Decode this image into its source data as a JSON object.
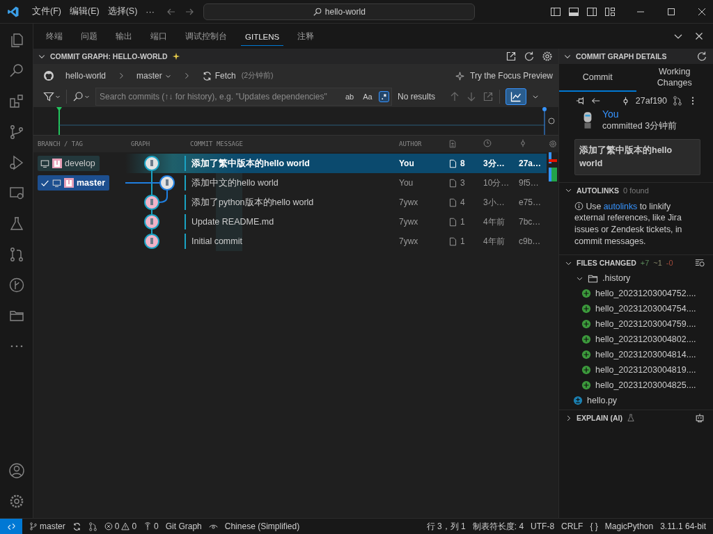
{
  "titlebar": {
    "menus": [
      "文件(F)",
      "编辑(E)",
      "选择(S)"
    ],
    "more": "···",
    "search_value": "hello-world"
  },
  "panel_tabs": [
    {
      "label": "终端",
      "selected": false
    },
    {
      "label": "问题",
      "selected": false
    },
    {
      "label": "输出",
      "selected": false
    },
    {
      "label": "端口",
      "selected": false
    },
    {
      "label": "调试控制台",
      "selected": false
    },
    {
      "label": "GITLENS",
      "selected": true
    },
    {
      "label": "注释",
      "selected": false
    }
  ],
  "graph": {
    "title": "COMMIT GRAPH: HELLO-WORLD",
    "repo": "hello-world",
    "branch": "master",
    "fetch": "Fetch",
    "fetch_time": "(2分钟前)",
    "focus": "Try the Focus Preview",
    "search_placeholder": "Search commits (↑↓ for history), e.g. \"Updates dependencies\"",
    "search_toggles": [
      {
        "label": "ab",
        "selected": false
      },
      {
        "label": "Aa",
        "selected": false
      },
      {
        "label": ".*",
        "selected": true
      }
    ],
    "no_results": "No results",
    "columns": [
      "BRANCH / TAG",
      "GRAPH",
      "COMMIT MESSAGE",
      "AUTHOR"
    ],
    "rows": [
      {
        "branch": {
          "name": "develop",
          "current": false
        },
        "kind": "main",
        "message": "添加了繁中版本的hello world",
        "author": "You",
        "files": "8",
        "time": "3分…",
        "sha": "27a…",
        "selected": true
      },
      {
        "branch": {
          "name": "master",
          "current": true
        },
        "kind": "side",
        "message": "添加中文的hello world",
        "author": "You",
        "files": "3",
        "time": "10分…",
        "sha": "9f5…",
        "selected": false
      },
      {
        "kind": "main",
        "message": "添加了python版本的hello world",
        "author": "7ywx",
        "files": "4",
        "time": "3小…",
        "sha": "e75…",
        "selected": false
      },
      {
        "kind": "main",
        "message": "Update README.md",
        "author": "7ywx",
        "files": "1",
        "time": "4年前",
        "sha": "7bc…",
        "selected": false
      },
      {
        "kind": "main",
        "message": "Initial commit",
        "author": "7ywx",
        "files": "1",
        "time": "4年前",
        "sha": "c9b…",
        "selected": false
      }
    ]
  },
  "details": {
    "title": "COMMIT GRAPH DETAILS",
    "tabs": [
      {
        "label": "Commit",
        "selected": true
      },
      {
        "label": "Working Changes",
        "selected": false
      }
    ],
    "sha": "27af190",
    "author": "You",
    "committed": "committed 3分钟前",
    "message": "添加了繁中版本的hello world",
    "autolinks": {
      "title": "AUTOLINKS",
      "count": "0 found",
      "before": "Use",
      "link": "autolinks",
      "after": "to linkify external references, like Jira issues or Zendesk tickets, in commit messages."
    },
    "files_changed": {
      "title": "FILES CHANGED",
      "added": "+7",
      "modified": "~1",
      "removed": "-0",
      "folder": {
        "name": ".history",
        "expanded": true,
        "files": [
          {
            "name": "hello_20231203004752....",
            "kind": "added"
          },
          {
            "name": "hello_20231203004754....",
            "kind": "added"
          },
          {
            "name": "hello_20231203004759....",
            "kind": "added"
          },
          {
            "name": "hello_20231203004802....",
            "kind": "added"
          },
          {
            "name": "hello_20231203004814....",
            "kind": "added"
          },
          {
            "name": "hello_20231203004819....",
            "kind": "added"
          },
          {
            "name": "hello_20231203004825....",
            "kind": "added"
          }
        ]
      },
      "files": [
        {
          "name": "hello.py",
          "kind": "modified"
        }
      ]
    },
    "explain": "EXPLAIN (AI)"
  },
  "statusbar": {
    "branch": "master",
    "errors": "0",
    "warnings": "0",
    "ports": "0",
    "git_graph": "Git Graph",
    "language_pack": "Chinese (Simplified)",
    "position": "行 3，列 1",
    "tab_size": "制表符长度: 4",
    "encoding": "UTF-8",
    "eol": "CRLF",
    "braces": "{ }",
    "language": "MagicPython",
    "interpreter": "3.11.1 64-bit"
  }
}
